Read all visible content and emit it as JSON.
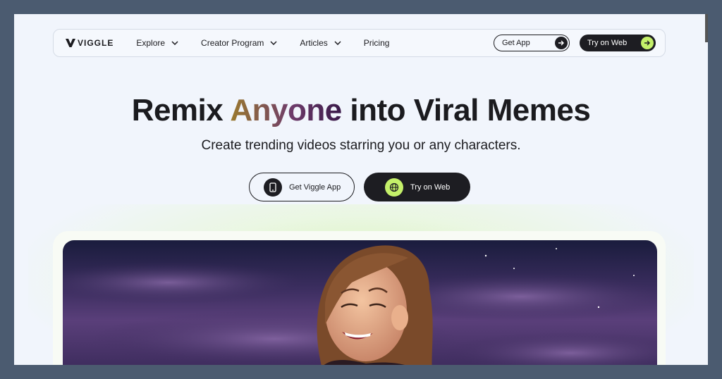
{
  "brand": {
    "name": "VIGGLE"
  },
  "nav": {
    "items": [
      {
        "label": "Explore",
        "has_dropdown": true
      },
      {
        "label": "Creator Program",
        "has_dropdown": true
      },
      {
        "label": "Articles",
        "has_dropdown": true
      },
      {
        "label": "Pricing",
        "has_dropdown": false
      }
    ],
    "get_app": "Get App",
    "try_web": "Try on Web"
  },
  "hero": {
    "title_before": "Remix ",
    "title_accent": "Anyone",
    "title_after": " into Viral Memes",
    "subtitle": "Create trending videos starring you or any characters.",
    "cta_app": "Get Viggle App",
    "cta_web": "Try on Web"
  },
  "colors": {
    "accent_lime": "#c4f06a",
    "dark": "#1d1d22",
    "background": "#f1f5fc"
  }
}
